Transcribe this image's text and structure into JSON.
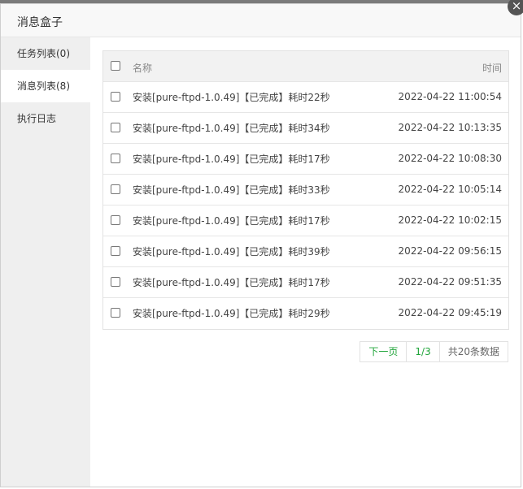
{
  "dialog": {
    "title": "消息盒子",
    "close_symbol": "×"
  },
  "sidebar": {
    "items": [
      {
        "label": "任务列表(0)"
      },
      {
        "label": "消息列表(8)",
        "active": true
      },
      {
        "label": "执行日志"
      }
    ]
  },
  "table": {
    "headers": {
      "name": "名称",
      "time": "时间"
    },
    "rows": [
      {
        "name": "安装[pure-ftpd-1.0.49]【已完成】耗时22秒",
        "time": "2022-04-22 11:00:54"
      },
      {
        "name": "安装[pure-ftpd-1.0.49]【已完成】耗时34秒",
        "time": "2022-04-22 10:13:35"
      },
      {
        "name": "安装[pure-ftpd-1.0.49]【已完成】耗时17秒",
        "time": "2022-04-22 10:08:30"
      },
      {
        "name": "安装[pure-ftpd-1.0.49]【已完成】耗时33秒",
        "time": "2022-04-22 10:05:14"
      },
      {
        "name": "安装[pure-ftpd-1.0.49]【已完成】耗时17秒",
        "time": "2022-04-22 10:02:15"
      },
      {
        "name": "安装[pure-ftpd-1.0.49]【已完成】耗时39秒",
        "time": "2022-04-22 09:56:15"
      },
      {
        "name": "安装[pure-ftpd-1.0.49]【已完成】耗时17秒",
        "time": "2022-04-22 09:51:35"
      },
      {
        "name": "安装[pure-ftpd-1.0.49]【已完成】耗时29秒",
        "time": "2022-04-22 09:45:19"
      }
    ]
  },
  "pagination": {
    "next_label": "下一页",
    "page_indicator": "1/3",
    "total_label": "共20条数据"
  },
  "colors": {
    "accent": "#20a53a"
  }
}
